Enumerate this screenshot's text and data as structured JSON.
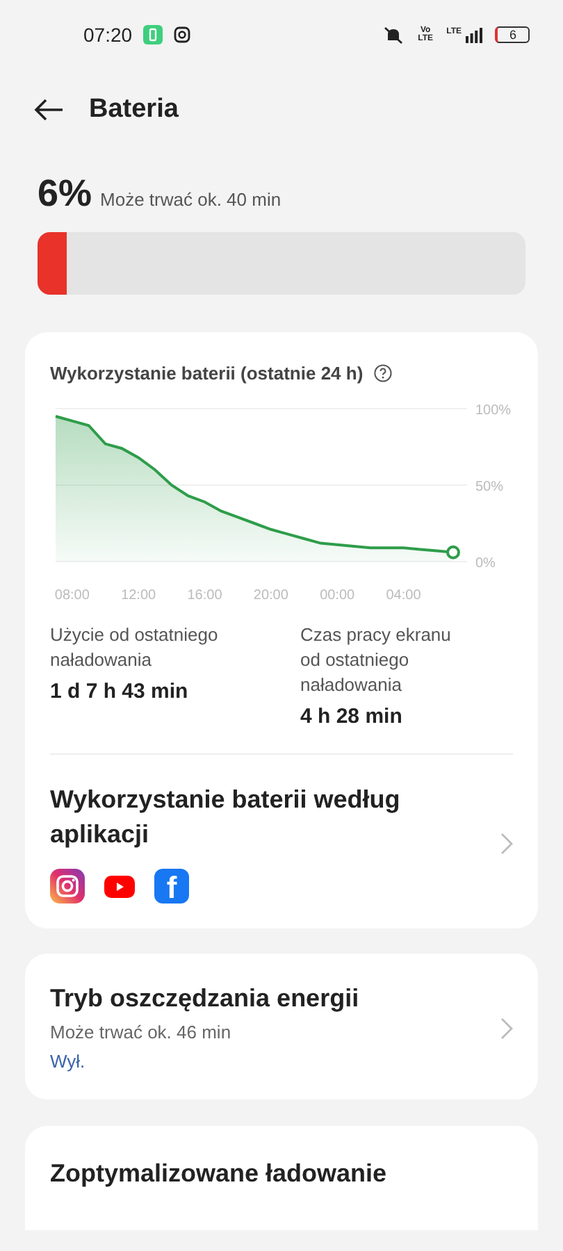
{
  "status_bar": {
    "time": "07:20",
    "volte": "Vo LTE",
    "network": "LTE",
    "battery": "6"
  },
  "header": {
    "title": "Bateria"
  },
  "battery": {
    "percent": "6%",
    "estimate": "Może trwać ok. 40 min",
    "level": 0.06
  },
  "usage": {
    "title": "Wykorzystanie baterii (ostatnie 24 h)",
    "chart_data": {
      "type": "area",
      "categories": [
        null,
        "08:00",
        null,
        null,
        null,
        "12:00",
        null,
        null,
        null,
        "16:00",
        null,
        null,
        null,
        "20:00",
        null,
        null,
        null,
        "00:00",
        null,
        null,
        null,
        "04:00",
        null,
        null,
        null
      ],
      "series": [
        {
          "color": "#2e9d4a",
          "values": [
            95,
            92,
            89,
            77,
            74,
            68,
            60,
            50,
            43,
            39,
            33,
            29,
            25,
            21,
            18,
            15,
            12,
            11,
            10,
            9,
            9,
            9,
            8,
            7,
            6
          ]
        }
      ],
      "ylim": [
        0,
        100
      ],
      "yticks": [
        {
          "value": 100,
          "label": "100%"
        },
        {
          "value": 50,
          "label": "50%"
        },
        {
          "value": 0,
          "label": "0%"
        }
      ]
    },
    "stats": [
      {
        "label": "Użycie od ostatniego naładowania",
        "value": "1 d 7 h 43 min"
      },
      {
        "label": "Czas pracy ekranu od ostatniego naładowania",
        "value": "4 h 28 min"
      }
    ],
    "apps_title": "Wykorzystanie baterii według aplikacji",
    "apps": [
      {
        "kind": "camera"
      },
      {
        "kind": "play"
      },
      {
        "kind": "letter",
        "glyph": "f"
      }
    ]
  },
  "power_saving": {
    "title": "Tryb oszczędzania energii",
    "subtitle": "Może trwać ok. 46 min",
    "status": "Wył."
  },
  "optimized_charging": {
    "title": "Zoptymalizowane ładowanie"
  }
}
